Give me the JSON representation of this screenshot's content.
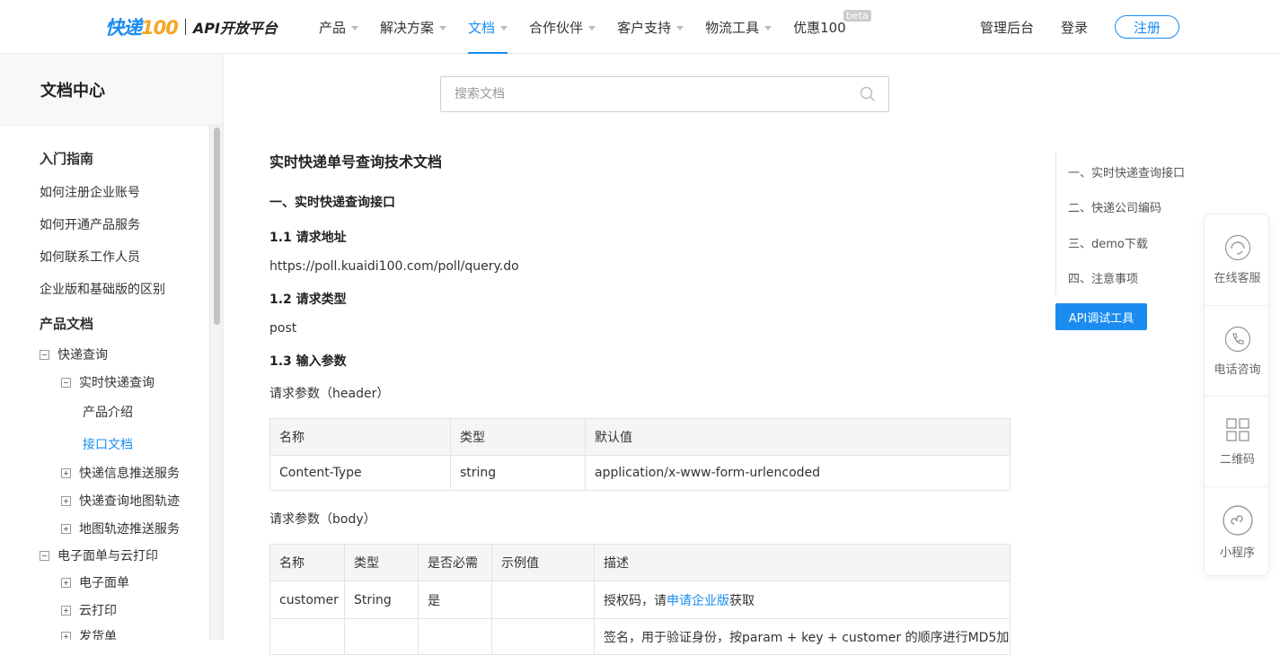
{
  "header": {
    "logo_brand": "快递",
    "logo_num": "100",
    "logo_sub": "API开放平台",
    "nav": [
      {
        "label": "产品",
        "caret": true
      },
      {
        "label": "解决方案",
        "caret": true
      },
      {
        "label": "文档",
        "caret": true,
        "active": true
      },
      {
        "label": "合作伙伴",
        "caret": true
      },
      {
        "label": "客户支持",
        "caret": true
      },
      {
        "label": "物流工具",
        "caret": true
      },
      {
        "label": "优惠100",
        "caret": false,
        "badge": "beta"
      }
    ],
    "admin_label": "管理后台",
    "login_label": "登录",
    "register_label": "注册"
  },
  "sidebar": {
    "title": "文档中心",
    "items": [
      {
        "label": "入门指南",
        "style": "bold"
      },
      {
        "label": "如何注册企业账号"
      },
      {
        "label": "如何开通产品服务"
      },
      {
        "label": "如何联系工作人员"
      },
      {
        "label": "企业版和基础版的区别"
      },
      {
        "label": "产品文档",
        "style": "bold"
      },
      {
        "label": "快递查询",
        "toggle": "minus"
      },
      {
        "label": "实时快递查询",
        "toggle": "minus"
      },
      {
        "label": "产品介绍"
      },
      {
        "label": "接口文档",
        "active": true
      },
      {
        "label": "快递信息推送服务",
        "toggle": "plus"
      },
      {
        "label": "快递查询地图轨迹",
        "toggle": "plus"
      },
      {
        "label": "地图轨迹推送服务",
        "toggle": "plus"
      },
      {
        "label": "电子面单与云打印",
        "toggle": "minus"
      },
      {
        "label": "电子面单",
        "toggle": "plus"
      },
      {
        "label": "云打印",
        "toggle": "plus"
      },
      {
        "label": "发货单",
        "toggle": "plus"
      }
    ]
  },
  "search": {
    "placeholder": "搜索文档"
  },
  "doc": {
    "title": "实时快递单号查询技术文档",
    "section1": "一、实时快递查询接口",
    "s11": "1.1 请求地址",
    "url": "https://poll.kuaidi100.com/poll/query.do",
    "s12": "1.2 请求类型",
    "method": "post",
    "s13": "1.3 输入参数",
    "header_params_label": "请求参数（header）",
    "header_table": {
      "columns": [
        "名称",
        "类型",
        "默认值"
      ],
      "rows": [
        [
          "Content-Type",
          "string",
          "application/x-www-form-urlencoded"
        ]
      ]
    },
    "body_params_label": "请求参数（body）",
    "body_table": {
      "columns": [
        "名称",
        "类型",
        "是否必需",
        "示例值",
        "描述"
      ],
      "row1": [
        "customer",
        "String",
        "是",
        ""
      ],
      "row1_desc_pre": "授权码，请",
      "row1_desc_link": "申请企业版",
      "row1_desc_post": "获取",
      "row2_desc": "签名，用于验证身份，按param + key + customer 的顺序进行MD5加"
    }
  },
  "toc": {
    "items": [
      "一、实时快递查询接口",
      "二、快递公司编码",
      "三、demo下载",
      "四、注意事项"
    ],
    "api_tool_label": "API调试工具"
  },
  "float_panel": {
    "items": [
      {
        "label": "在线客服",
        "icon": "headset-icon"
      },
      {
        "label": "电话咨询",
        "icon": "phone-icon"
      },
      {
        "label": "二维码",
        "icon": "qrcode-icon"
      },
      {
        "label": "小程序",
        "icon": "miniprogram-icon"
      }
    ]
  },
  "colors": {
    "accent": "#1a8cf0",
    "logo_orange": "#f5a623"
  }
}
